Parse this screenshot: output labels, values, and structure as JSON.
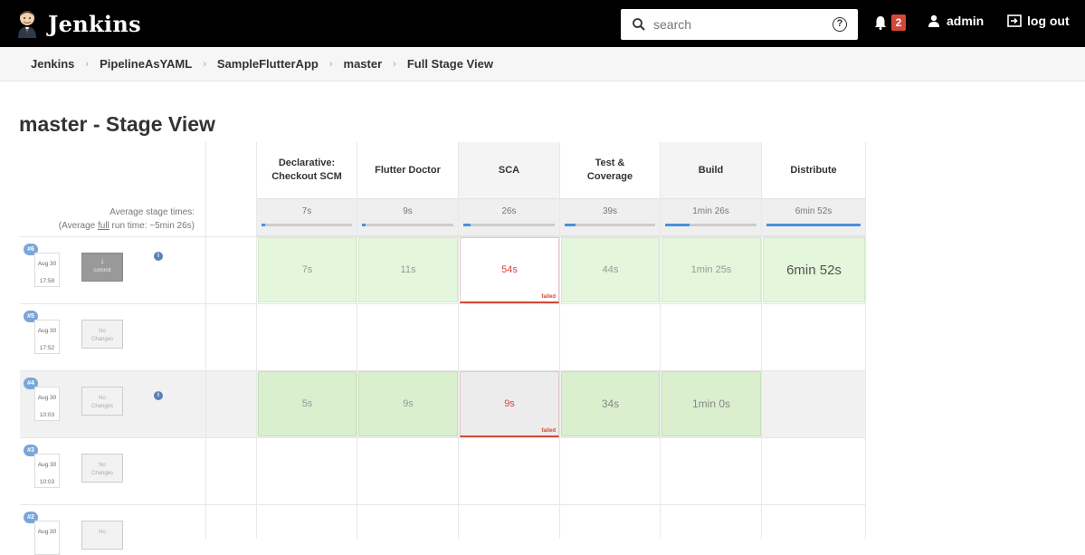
{
  "header": {
    "app_name": "Jenkins",
    "search_placeholder": "search",
    "help_label": "?",
    "notification_count": "2",
    "user_name": "admin",
    "logout_label": "log out"
  },
  "breadcrumbs": [
    "Jenkins",
    "PipelineAsYAML",
    "SampleFlutterApp",
    "master",
    "Full Stage View"
  ],
  "page_title": "master - Stage View",
  "average": {
    "label_line1": "Average stage times:",
    "label_line2_pre": "(Average ",
    "label_line2_link": "full",
    "label_line2_post": " run time: ~5min 26s)"
  },
  "stages": [
    {
      "name_line1": "Declarative:",
      "name_line2": "Checkout SCM",
      "avg": "7s",
      "avg_fill": 0.02
    },
    {
      "name_line1": "Flutter Doctor",
      "name_line2": "",
      "avg": "9s",
      "avg_fill": 0.03
    },
    {
      "name_line1": "SCA",
      "name_line2": "",
      "avg": "26s",
      "avg_fill": 0.08
    },
    {
      "name_line1": "Test &",
      "name_line2": "Coverage",
      "avg": "39s",
      "avg_fill": 0.12
    },
    {
      "name_line1": "Build",
      "name_line2": "",
      "avg": "1min 26s",
      "avg_fill": 0.27
    },
    {
      "name_line1": "Distribute",
      "name_line2": "",
      "avg": "6min 52s",
      "avg_fill": 1.0
    }
  ],
  "builds": [
    {
      "number": "#6",
      "date": "Aug 30",
      "time": "17:58",
      "changes_line1": "1",
      "changes_line2": "commit",
      "cells": [
        "7s",
        "11s",
        "54s",
        "44s",
        "1min 25s",
        "6min 52s"
      ],
      "failed_label": "failed"
    },
    {
      "number": "#5",
      "date": "Aug 30",
      "time": "17:52",
      "changes_line1": "No",
      "changes_line2": "Changes"
    },
    {
      "number": "#4",
      "date": "Aug 30",
      "time": "10:03",
      "changes_line1": "No",
      "changes_line2": "Changes",
      "cells": [
        "5s",
        "9s",
        "9s",
        "34s",
        "1min 0s"
      ],
      "failed_label": "failed"
    },
    {
      "number": "#3",
      "date": "Aug 30",
      "time": "10:03",
      "changes_line1": "No",
      "changes_line2": "Changes"
    },
    {
      "number": "#2",
      "date": "Aug 30",
      "changes_line1": "No",
      "changes_line2": ""
    }
  ],
  "colors": {
    "topbar": "#000000",
    "success": "#e4f6dc",
    "failed": "#d24939",
    "progress": "#4a90d9"
  }
}
